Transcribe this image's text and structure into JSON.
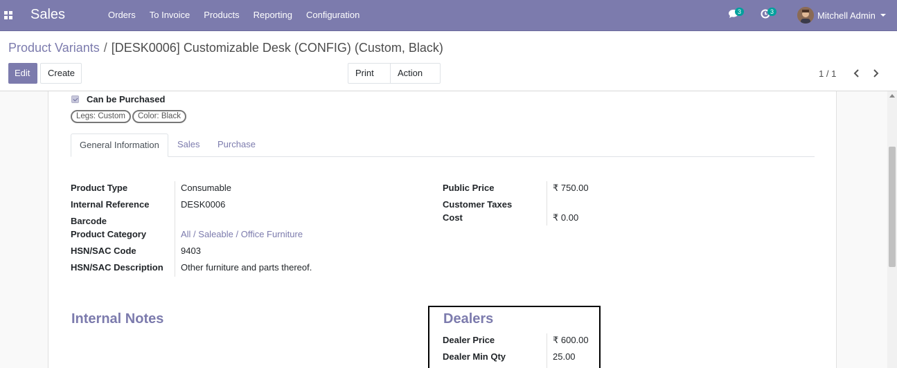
{
  "navbar": {
    "brand": "Sales",
    "menu": [
      "Orders",
      "To Invoice",
      "Products",
      "Reporting",
      "Configuration"
    ],
    "messages_count": "3",
    "activities_count": "3",
    "user_name": "Mitchell Admin"
  },
  "breadcrumb": {
    "parent": "Product Variants",
    "separator": "/",
    "current": "[DESK0006] Customizable Desk (CONFIG) (Custom, Black)"
  },
  "toolbar": {
    "edit_label": "Edit",
    "create_label": "Create",
    "print_label": "Print",
    "action_label": "Action",
    "pager": "1 / 1"
  },
  "form": {
    "can_be_purchased_label": "Can be Purchased",
    "tags": [
      "Legs: Custom",
      "Color: Black"
    ],
    "tabs": [
      "General Information",
      "Sales",
      "Purchase"
    ],
    "left_fields": [
      {
        "label": "Product Type",
        "value": "Consumable"
      },
      {
        "label": "Internal Reference",
        "value": "DESK0006"
      },
      {
        "label": "Barcode",
        "value": ""
      },
      {
        "label": "Product Category",
        "value": "All / Saleable / Office Furniture"
      },
      {
        "label": "HSN/SAC Code",
        "value": "9403"
      },
      {
        "label": "HSN/SAC Description",
        "value": "Other furniture and parts thereof."
      }
    ],
    "right_fields": [
      {
        "label": "Public Price",
        "value": "₹ 750.00"
      },
      {
        "label": "Customer Taxes",
        "value": ""
      },
      {
        "label": "Cost",
        "value": "₹ 0.00"
      }
    ],
    "internal_notes_title": "Internal Notes",
    "dealers_title": "Dealers",
    "dealer_fields": [
      {
        "label": "Dealer Price",
        "value": "₹ 600.00"
      },
      {
        "label": "Dealer Min Qty",
        "value": "25.00"
      }
    ]
  },
  "colors": {
    "brand": "#7c7bad",
    "badge": "#00a09d"
  }
}
